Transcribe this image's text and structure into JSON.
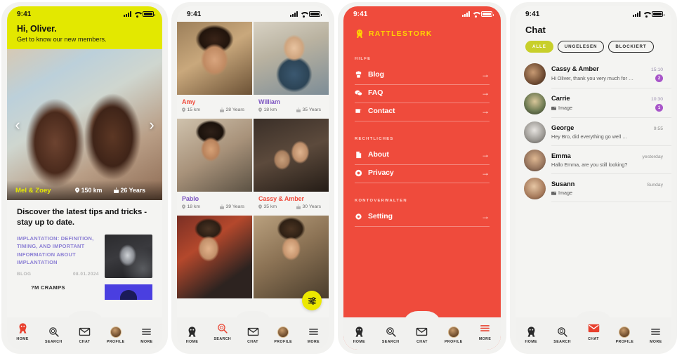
{
  "status_bar": {
    "time": "9:41"
  },
  "phone1": {
    "greeting": "Hi, Oliver.",
    "subtitle": "Get to know our new members.",
    "carousel": {
      "prev_icon": "chevron-left-icon",
      "next_icon": "chevron-right-icon",
      "name": "Mel & Zoey",
      "distance": "150 km",
      "age": "26 Years"
    },
    "blog": {
      "title": "Discover the latest tips and tricks - stay up to date.",
      "articles": [
        {
          "headline": "IMPLANTATION: DEFINITION, TIMING, AND IMPORTANT INFORMATION ABOUT IMPLANTATION",
          "category": "BLOG",
          "date": "08.01.2024"
        },
        {
          "headline": "?M CRAMPS",
          "category": "",
          "date": ""
        }
      ]
    },
    "tabs": [
      {
        "label": "HOME",
        "icon": "stork-icon",
        "active": true
      },
      {
        "label": "SEARCH",
        "icon": "search-icon",
        "active": false
      },
      {
        "label": "CHAT",
        "icon": "envelope-icon",
        "active": false
      },
      {
        "label": "PROFILE",
        "icon": "avatar-icon",
        "active": false
      },
      {
        "label": "MORE",
        "icon": "hamburger-icon",
        "active": false
      }
    ]
  },
  "phone2": {
    "members": [
      {
        "name": "Amy",
        "distance": "15 km",
        "age": "28 Years",
        "color": "red"
      },
      {
        "name": "William",
        "distance": "18 km",
        "age": "35 Years",
        "color": "purple"
      },
      {
        "name": "Pablo",
        "distance": "18 km",
        "age": "39 Years",
        "color": "purple"
      },
      {
        "name": "Cassy & Amber",
        "distance": "35 km",
        "age": "30 Years",
        "color": "red"
      }
    ],
    "filter_button_icon": "sliders-icon",
    "tabs": [
      {
        "label": "HOME",
        "icon": "stork-icon",
        "active": false
      },
      {
        "label": "SEARCH",
        "icon": "search-icon",
        "active": true
      },
      {
        "label": "CHAT",
        "icon": "envelope-icon",
        "active": false
      },
      {
        "label": "PROFILE",
        "icon": "avatar-icon",
        "active": false
      },
      {
        "label": "MORE",
        "icon": "hamburger-icon",
        "active": false
      }
    ]
  },
  "phone3": {
    "brand": "RATTLESTORK",
    "sections": [
      {
        "title": "HILFE",
        "items": [
          {
            "label": "Blog",
            "icon": "blog-icon"
          },
          {
            "label": "FAQ",
            "icon": "faq-icon"
          },
          {
            "label": "Contact",
            "icon": "contact-icon"
          }
        ]
      },
      {
        "title": "RECHTLICHES",
        "items": [
          {
            "label": "About",
            "icon": "document-icon"
          },
          {
            "label": "Privacy",
            "icon": "shield-icon"
          }
        ]
      },
      {
        "title": "KONTOVERWALTEN",
        "items": [
          {
            "label": "Setting",
            "icon": "gear-icon"
          }
        ]
      }
    ],
    "arrow_icon": "arrow-right-icon",
    "tabs": [
      {
        "label": "HOME",
        "icon": "stork-icon",
        "active": false
      },
      {
        "label": "SEARCH",
        "icon": "search-icon",
        "active": false
      },
      {
        "label": "CHAT",
        "icon": "envelope-icon",
        "active": false
      },
      {
        "label": "PROFILE",
        "icon": "avatar-icon",
        "active": false
      },
      {
        "label": "MORE",
        "icon": "hamburger-icon",
        "active": true
      }
    ]
  },
  "phone4": {
    "title": "Chat",
    "filters": [
      {
        "label": "ALLE",
        "active": true
      },
      {
        "label": "UNGELESEN",
        "active": false
      },
      {
        "label": "BLOCKIERT",
        "active": false
      }
    ],
    "conversations": [
      {
        "name": "Cassy & Amber",
        "preview": "Hi Oliver, thank you very much for  …",
        "time": "15:10",
        "unread": "2",
        "is_image": false
      },
      {
        "name": "Carrie",
        "preview": "Image",
        "time": "10:30",
        "unread": "1",
        "is_image": true
      },
      {
        "name": "George",
        "preview": "Hey Bro, did everything go well …",
        "time": "9:55",
        "unread": "",
        "is_image": false
      },
      {
        "name": "Emma",
        "preview": "Hallo Emma, are you still looking?",
        "time": "yesterday",
        "unread": "",
        "is_image": false
      },
      {
        "name": "Susann",
        "preview": "Image",
        "time": "Sunday",
        "unread": "",
        "is_image": true
      }
    ],
    "tabs": [
      {
        "label": "HOME",
        "icon": "stork-icon",
        "active": false
      },
      {
        "label": "SEARCH",
        "icon": "search-icon",
        "active": false
      },
      {
        "label": "CHAT",
        "icon": "envelope-icon",
        "active": true
      },
      {
        "label": "PROFILE",
        "icon": "avatar-icon",
        "active": false
      },
      {
        "label": "MORE",
        "icon": "hamburger-icon",
        "active": false
      }
    ]
  },
  "colors": {
    "yellow": "#e3e800",
    "red": "#ef4b3c",
    "purple": "#7e57c2",
    "badge_purple": "#a855c9",
    "pill_olive": "#c8cf2a",
    "brand_yellow": "#ffd400"
  }
}
